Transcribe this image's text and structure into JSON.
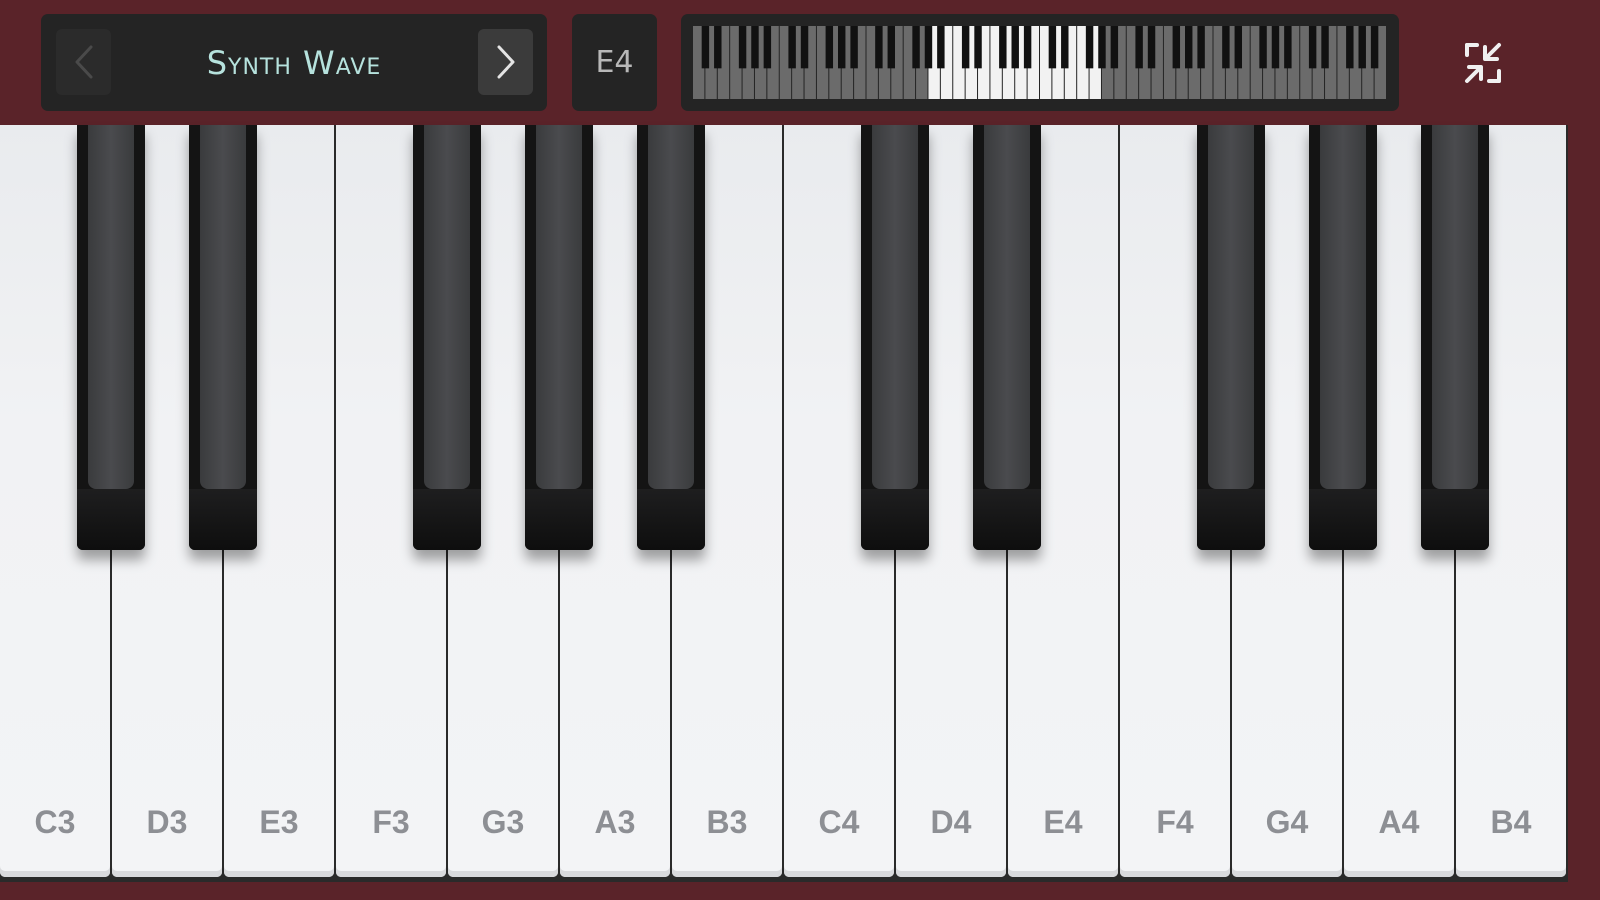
{
  "header": {
    "preset_name": "Synth Wave",
    "current_note": "E4"
  },
  "icons": {
    "prev": "chevron-left-icon",
    "next": "chevron-right-icon",
    "collapse": "collapse-arrows-icon"
  },
  "colors": {
    "topbar": "#5a2329",
    "panel": "#242424",
    "preset_text": "#b6e2dd",
    "white_key": "#f1f2f4",
    "black_key": "#141414"
  },
  "keyboard": {
    "white_keys": [
      "C3",
      "D3",
      "E3",
      "F3",
      "G3",
      "A3",
      "B3",
      "C4",
      "D4",
      "E4",
      "F4",
      "G4",
      "A4",
      "B4"
    ],
    "black_keys": [
      "C#3",
      "D#3",
      "F#3",
      "G#3",
      "A#3",
      "C#4",
      "D#4",
      "F#4",
      "G#4",
      "A#4"
    ]
  }
}
